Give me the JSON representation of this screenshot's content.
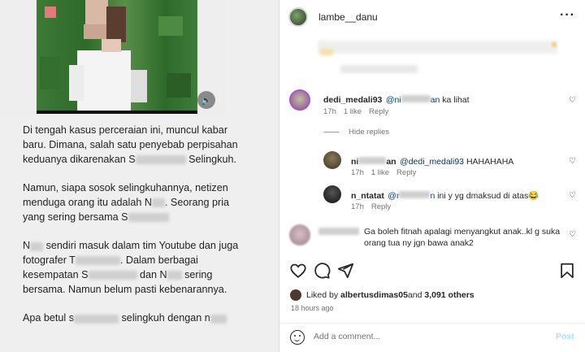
{
  "left": {
    "paragraphs": [
      {
        "parts": [
          "Di tengah kasus perceraian ini, muncul kabar baru. Dimana, salah satu penyebab perpisahan keduanya dikarenakan S",
          "",
          " Selingkuh."
        ]
      },
      {
        "parts": [
          "Namun, siapa sosok selingkuhannya, netizen menduga orang itu adalah N",
          "",
          ". Seorang pria yang sering bersama S",
          "",
          ""
        ]
      },
      {
        "parts": [
          "N",
          "",
          " sendiri masuk dalam tim Youtube dan juga fotografer T",
          "",
          ". Dalam berbagai kesempatan S",
          "",
          " dan N",
          "",
          " sering bersama. Namun belum pasti kebenarannya."
        ]
      },
      {
        "parts": [
          "Apa betul s",
          "",
          " selingkuh dengan n",
          "",
          ""
        ]
      }
    ],
    "sound_icon": "speaker-icon"
  },
  "post": {
    "username": "lambe__danu",
    "more_icon": "more-horizontal-icon"
  },
  "comments": [
    {
      "user": "dedi_medali93",
      "mention": "@ni",
      "mention_tail": "an",
      "text": " ka lihat",
      "time": "17h",
      "likes": "1 like",
      "reply": "Reply"
    },
    {
      "user": "ni",
      "user_tail": "an",
      "mention": "@dedi_medali93",
      "text": " HAHAHAHA",
      "time": "17h",
      "likes": "1 like",
      "reply": "Reply"
    },
    {
      "user": "n_ntatat",
      "mention": "@r",
      "mention_tail": "n",
      "text": " ini y yg dmaksud di atas😂",
      "time": "17h",
      "reply": "Reply"
    },
    {
      "text": "Ga boleh fitnah apalagi menyangkut anak..kl g suka orang tua ny jgn bawa anak2"
    }
  ],
  "hide_replies": "Hide replies",
  "likes": {
    "liked_by": "Liked by ",
    "user": "albertusdimas05",
    "and": " and ",
    "count": "3,091 others"
  },
  "time_ago": "18 hours ago",
  "add_comment": {
    "placeholder": "Add a comment...",
    "post": "Post"
  }
}
